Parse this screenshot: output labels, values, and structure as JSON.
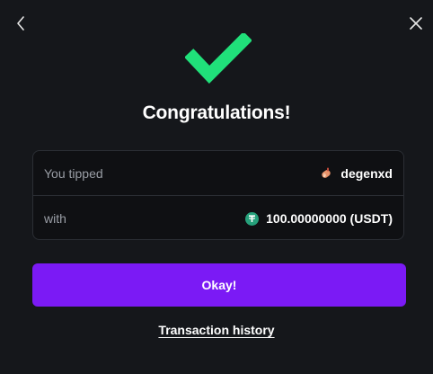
{
  "header": {
    "back_icon": "chevron-left-icon",
    "close_icon": "close-icon"
  },
  "success": {
    "icon": "checkmark-icon",
    "title": "Congratulations!",
    "accent_color": "#20e07a"
  },
  "details": {
    "tipped_label": "You tipped",
    "recipient_name": "degenxd",
    "recipient_avatar_icon": "avatar-icon",
    "with_label": "with",
    "amount": "100.00000000 (USDT)",
    "currency_icon": "usdt-icon",
    "currency_color": "#26a17b"
  },
  "actions": {
    "okay_label": "Okay!",
    "okay_color": "#7b1af5",
    "history_label": "Transaction history"
  }
}
